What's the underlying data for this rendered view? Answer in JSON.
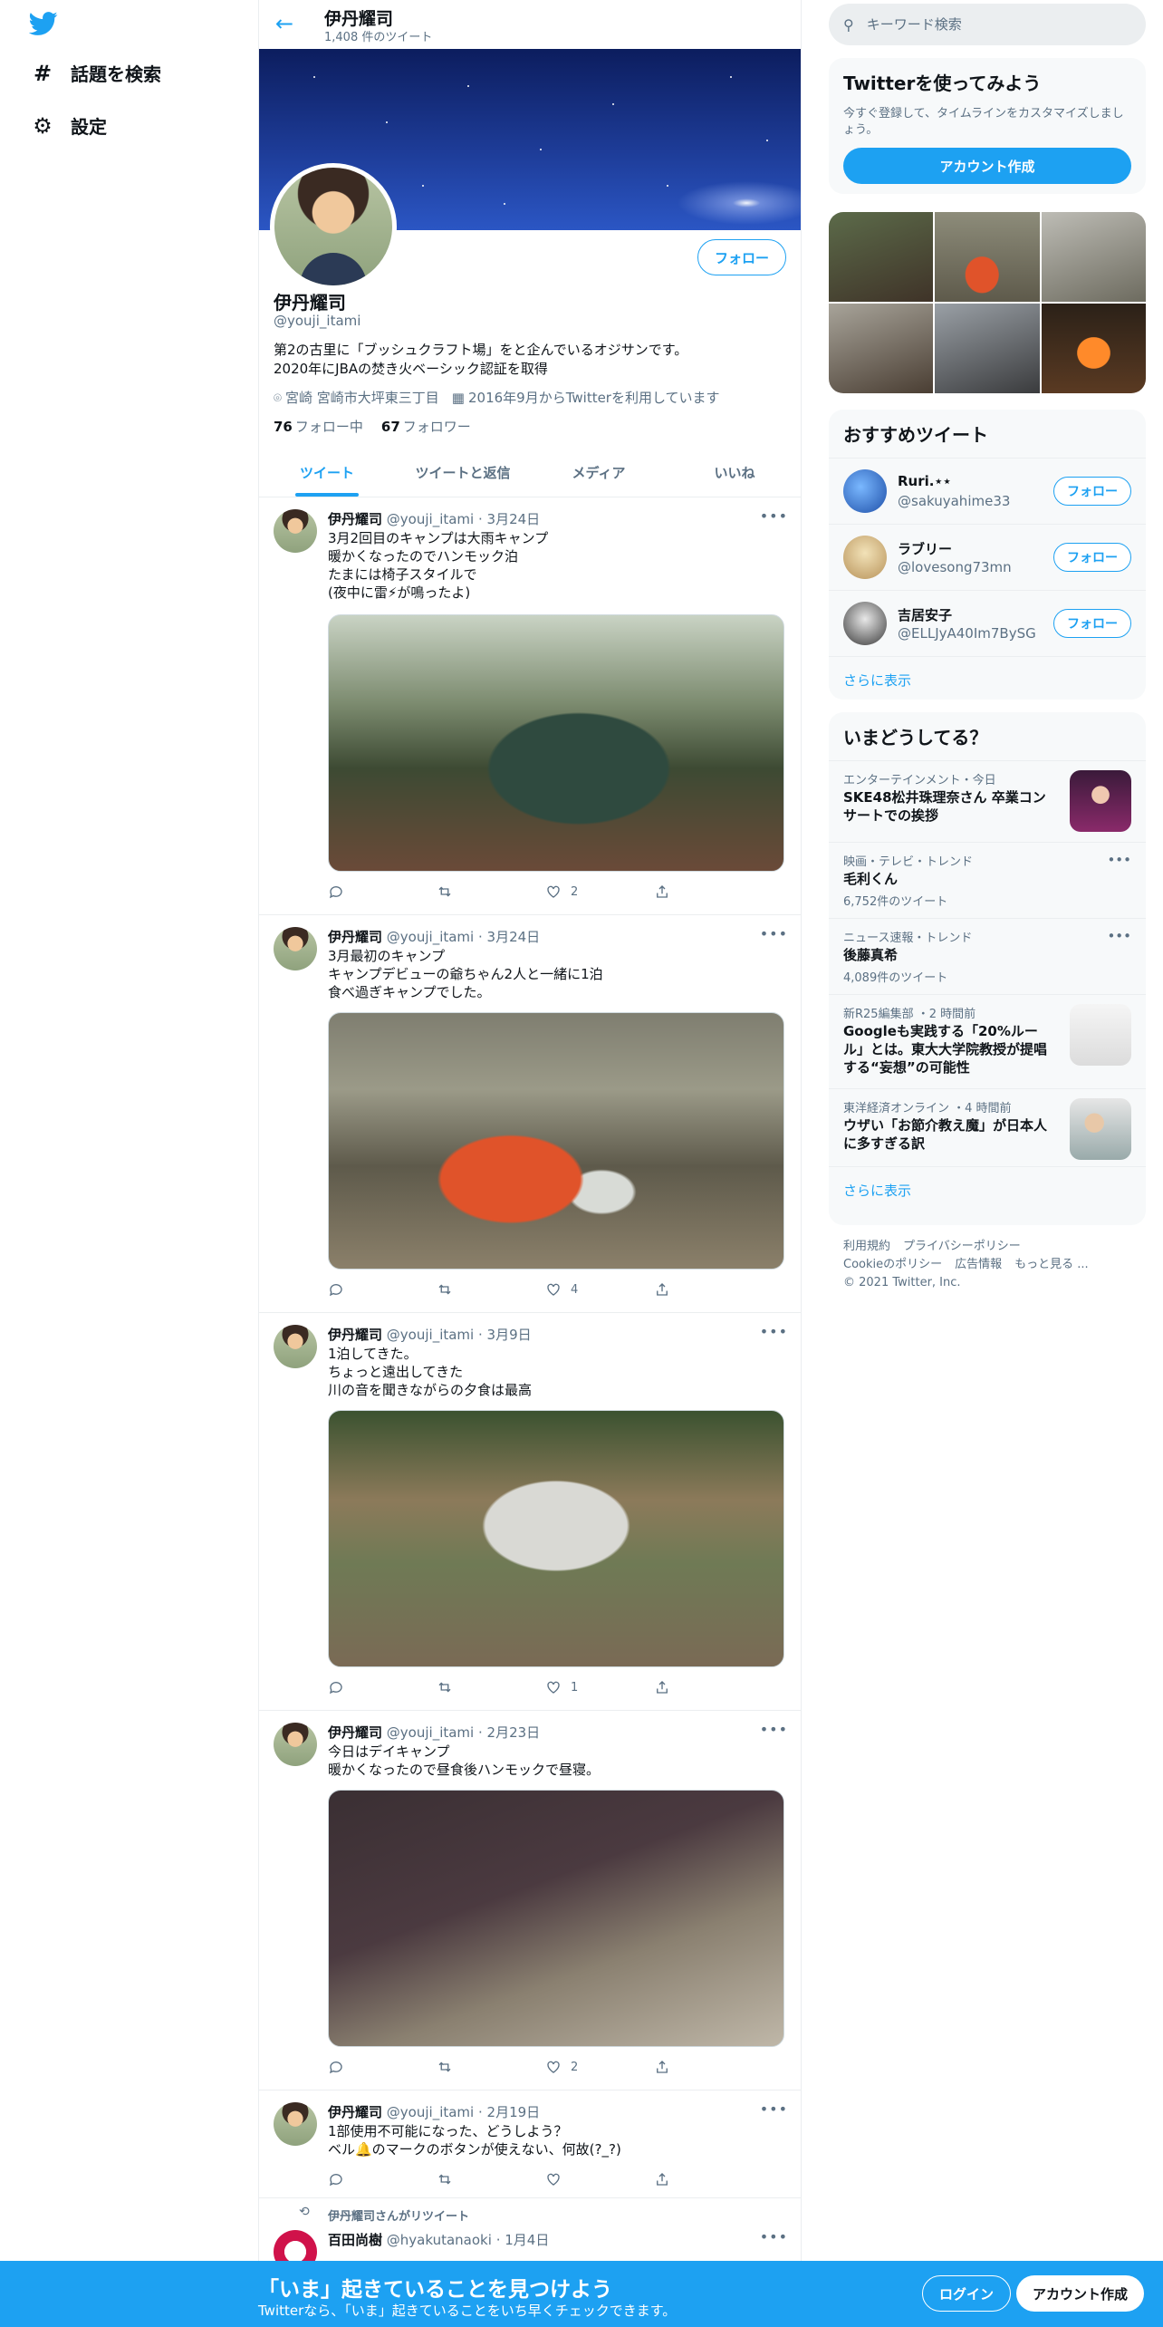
{
  "nav": {
    "explore_label": "話題を検索",
    "settings_label": "設定"
  },
  "header": {
    "name": "伊丹耀司",
    "tweet_count": "1,408 件のツイート"
  },
  "profile": {
    "name": "伊丹耀司",
    "handle": "@youji_itami",
    "follow_label": "フォロー",
    "bio_line1": "第2の古里に「ブッシュクラフト場」をと企んでいるオジサンです。",
    "bio_line2": "2020年にJBAの焚き火ベーシック認証を取得",
    "location": "宮崎 宮崎市大坪東三丁目",
    "joined": "2016年9月からTwitterを利用しています",
    "following_count": "76",
    "following_label": "フォロー中",
    "followers_count": "67",
    "followers_label": "フォロワー"
  },
  "tabs": [
    "ツイート",
    "ツイートと返信",
    "メディア",
    "いいね"
  ],
  "tweets": [
    {
      "name": "伊丹耀司",
      "handle": "@youji_itami",
      "date": "3月24日",
      "text": "3月2回目のキャンプは大雨キャンプ\n暖かくなったのでハンモック泊\nたまには椅子スタイルで\n(夜中に雷⚡が鳴ったよ)",
      "likes": "2"
    },
    {
      "name": "伊丹耀司",
      "handle": "@youji_itami",
      "date": "3月24日",
      "text": "3月最初のキャンプ\nキャンプデビューの爺ちゃん2人と一緒に1泊\n食べ過ぎキャンプでした。",
      "likes": "4"
    },
    {
      "name": "伊丹耀司",
      "handle": "@youji_itami",
      "date": "3月9日",
      "text": "1泊してきた。\nちょっと遠出してきた\n川の音を聞きながらの夕食は最高",
      "likes": "1"
    },
    {
      "name": "伊丹耀司",
      "handle": "@youji_itami",
      "date": "2月23日",
      "text": "今日はデイキャンプ\n暖かくなったので昼食後ハンモックで昼寝。",
      "likes": "2"
    },
    {
      "name": "伊丹耀司",
      "handle": "@youji_itami",
      "date": "2月19日",
      "text": "1部使用不可能になった、どうしよう？\nベル🔔のマークのボタンが使えない、何故(?_?)",
      "likes": ""
    }
  ],
  "retweet": {
    "label": "伊丹耀司さんがリツイート",
    "name": "百田尚樹",
    "handle": "@hyakutanaoki",
    "date": "1月4日"
  },
  "search": {
    "placeholder": "キーワード検索"
  },
  "signup": {
    "title": "Twitterを使ってみよう",
    "desc": "今すぐ登録して、タイムラインをカスタマイズしましょう。",
    "button": "アカウント作成"
  },
  "recommend": {
    "title": "おすすめツイート",
    "users": [
      {
        "name": "Ruri.⋆⋆",
        "handle": "@sakuyahime33",
        "follow": "フォロー"
      },
      {
        "name": "ラブリー",
        "handle": "@lovesong73mn",
        "follow": "フォロー"
      },
      {
        "name": "吉居安子",
        "handle": "@ELLJyA40Im7BySG",
        "follow": "フォロー"
      }
    ],
    "more": "さらに表示"
  },
  "trends": {
    "title": "いまどうしてる？",
    "items": [
      {
        "meta": "エンターテインメント・今日",
        "title": "SKE48松井珠理奈さん 卒業コンサートでの挨拶",
        "count": ""
      },
      {
        "meta": "映画・テレビ・トレンド",
        "title": "毛利くん",
        "count": "6,752件のツイート"
      },
      {
        "meta": "ニュース速報・トレンド",
        "title": "後藤真希",
        "count": "4,089件のツイート"
      },
      {
        "meta": "新R25編集部 ・2 時間前",
        "title": "Googleも実践する「20%ルール」とは。東大大学院教授が提唱する“妄想”の可能性",
        "count": ""
      },
      {
        "meta": "東洋経済オンライン ・4 時間前",
        "title": "ウザい「お節介教え魔」が日本人に多すぎる訳",
        "count": ""
      }
    ],
    "more": "さらに表示"
  },
  "footer": {
    "links": [
      "利用規約",
      "プライバシーポリシー",
      "Cookieのポリシー",
      "広告情報",
      "もっと見る ..."
    ],
    "copyright": "© 2021 Twitter, Inc."
  },
  "bottom": {
    "title": "「いま」起きていることを見つけよう",
    "sub": "Twitterなら、「いま」起きていることをいち早くチェックできます。",
    "login": "ログイン",
    "signup": "アカウント作成"
  },
  "colors": {
    "accent": "#1da1f2",
    "muted": "#5b7083"
  }
}
